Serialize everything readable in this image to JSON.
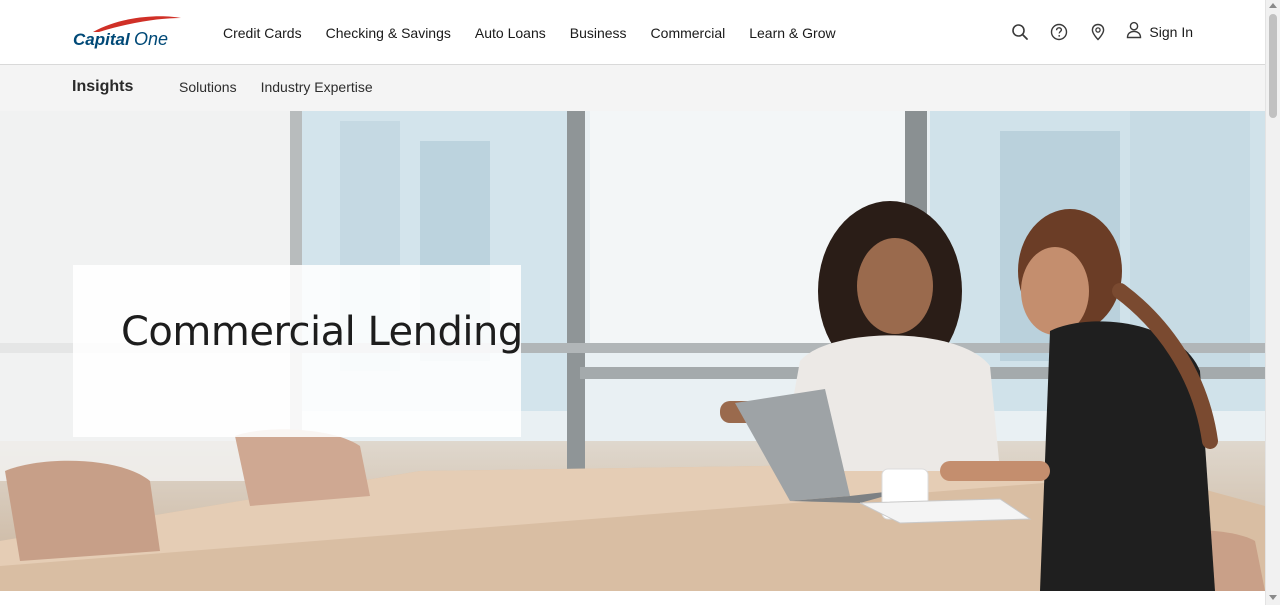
{
  "brand": {
    "name": "Capital One",
    "colors": {
      "navy": "#004977",
      "red": "#d03027"
    }
  },
  "header": {
    "nav": [
      {
        "label": "Credit Cards"
      },
      {
        "label": "Checking & Savings"
      },
      {
        "label": "Auto Loans"
      },
      {
        "label": "Business"
      },
      {
        "label": "Commercial"
      },
      {
        "label": "Learn & Grow"
      }
    ],
    "utility": {
      "search_icon": "search-icon",
      "help_icon": "question-circle-icon",
      "location_icon": "map-pin-icon",
      "user_icon": "user-icon",
      "signin_label": "Sign In"
    }
  },
  "subnav": {
    "title": "Insights",
    "links": [
      {
        "label": "Solutions"
      },
      {
        "label": "Industry Expertise"
      }
    ]
  },
  "hero": {
    "title": "Commercial Lending",
    "image_description": "two women at an office table with a laptop"
  }
}
